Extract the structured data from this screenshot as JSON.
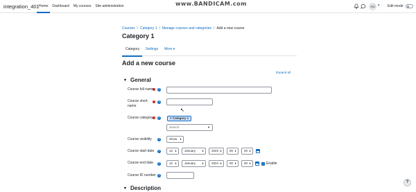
{
  "navbar": {
    "site_name": "integration_401",
    "links": [
      "Home",
      "Dashboard",
      "My courses",
      "Site administration"
    ],
    "watermark": "www.BANDICAM.com",
    "avatar_initials": "AU",
    "edit_mode_label": "Edit mode",
    "icons": [
      "bell-icon",
      "chat-icon",
      "chevron-down-icon"
    ]
  },
  "breadcrumb": {
    "items": [
      "Courses",
      "Category 1",
      "Manage courses and categories"
    ],
    "current": "Add a new course"
  },
  "page_title": "Category 1",
  "tabs": {
    "category": "Category",
    "settings": "Settings",
    "more": "More"
  },
  "form": {
    "heading": "Add a new course",
    "expand_all": "Expand all",
    "section_general": "General",
    "section_description": "Description",
    "fields": {
      "fullname_label": "Course full name",
      "shortname_label_1": "Course short",
      "shortname_label_2": "name",
      "category_label": "Course category",
      "category_selected": "Category 1",
      "category_search_placeholder": "Search",
      "visibility_label": "Course visibility",
      "visibility_value": "Show",
      "start_label": "Course start date",
      "start_day": "12",
      "start_month": "January",
      "start_year": "2023",
      "start_hour": "00",
      "start_minute": "00",
      "end_label": "Course end date",
      "end_day": "12",
      "end_month": "January",
      "end_year": "2024",
      "end_hour": "00",
      "end_minute": "00",
      "enable_label": "Enable",
      "idnumber_label": "Course ID number"
    }
  },
  "help_fab": "?",
  "colors": {
    "accent": "#0f6cbf",
    "required": "#ca3120",
    "text": "#1d2125",
    "border": "#8f959e"
  }
}
